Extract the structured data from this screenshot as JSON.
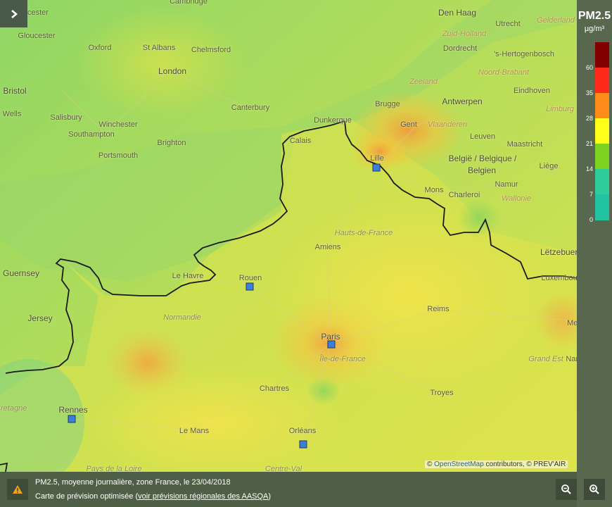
{
  "legend": {
    "title": "PM2.5",
    "unit": "µg/m³",
    "ticks": [
      "60",
      "35",
      "28",
      "21",
      "14",
      "7",
      "0"
    ],
    "colors": [
      "#800000",
      "#ff2a1a",
      "#ff8c1a",
      "#ffff1a",
      "#7ed321",
      "#2ecc9a",
      "#22c3a0"
    ]
  },
  "places": {
    "worcester": "Worcester",
    "cambridge": "Cambridge",
    "gloucester": "Gloucester",
    "oxford": "Oxford",
    "st_albans": "St Albans",
    "chelmsford": "Chelmsford",
    "london": "London",
    "bristol": "Bristol",
    "wells": "Wells",
    "salisbury": "Salisbury",
    "winchester": "Winchester",
    "southampton": "Southampton",
    "portsmouth": "Portsmouth",
    "brighton": "Brighton",
    "canterbury": "Canterbury",
    "den_haag": "Den Haag",
    "utrecht": "Utrecht",
    "gelderland": "Gelderland",
    "zuid_holland": "Zuid-Holland",
    "dordrecht": "Dordrecht",
    "hertogenbosch": "'s-Hertogenbosch",
    "noord_brabant": "Noord-Brabant",
    "zeeland": "Zeeland",
    "eindhoven": "Eindhoven",
    "antwerpen": "Antwerpen",
    "brugge": "Brugge",
    "gent": "Gent",
    "vlaanderen": "Vlaanderen",
    "dunkerque": "Dunkerque",
    "calais": "Calais",
    "lille": "Lille",
    "leuven": "Leuven",
    "limburg": "Limburg",
    "maastricht": "Maastricht",
    "belgie": "België / Belgique /",
    "belgien": "Belgien",
    "liege": "Liège",
    "namur": "Namur",
    "mons": "Mons",
    "charleroi": "Charleroi",
    "wallonie": "Wallonie",
    "hauts_de_france": "Hauts-de-France",
    "amiens": "Amiens",
    "letzebuerg": "Lëtzebuerg",
    "luxembourg": "Luxembourg",
    "guernsey": "Guernsey",
    "jersey": "Jersey",
    "le_havre": "Le Havre",
    "rouen": "Rouen",
    "normandie": "Normandie",
    "reims": "Reims",
    "metz": "Metz",
    "paris": "Paris",
    "ile_de_france": "Île-de-France",
    "grand_est": "Grand Est",
    "nancy": "Nancy",
    "chartres": "Chartres",
    "troyes": "Troyes",
    "bretagne": "Bretagne",
    "rennes": "Rennes",
    "le_mans": "Le Mans",
    "orleans": "Orléans",
    "pays_de_la_loire": "Pays de la Loire",
    "centre": "Centre-Val"
  },
  "attribution": {
    "copyright": "©",
    "osm_link": "OpenStreetMap",
    "rest": " contributors, © PREV'AIR"
  },
  "caption": {
    "line1": "PM2.5, moyenne journalière, zone France, le 23/04/2018",
    "line2_prefix": "Carte de prévision optimisée (",
    "line2_link": "voir prévisions régionales des AASQA",
    "line2_suffix": ")"
  },
  "icons": {
    "sidebar_toggle": "chevron-right-icon",
    "warning": "warning-icon",
    "zoom_out": "zoom-out-icon",
    "zoom_in": "zoom-in-icon"
  },
  "colors": {
    "station": "#3b7fd6",
    "panel": "#58684f",
    "coastline": "#1a1a1a"
  }
}
